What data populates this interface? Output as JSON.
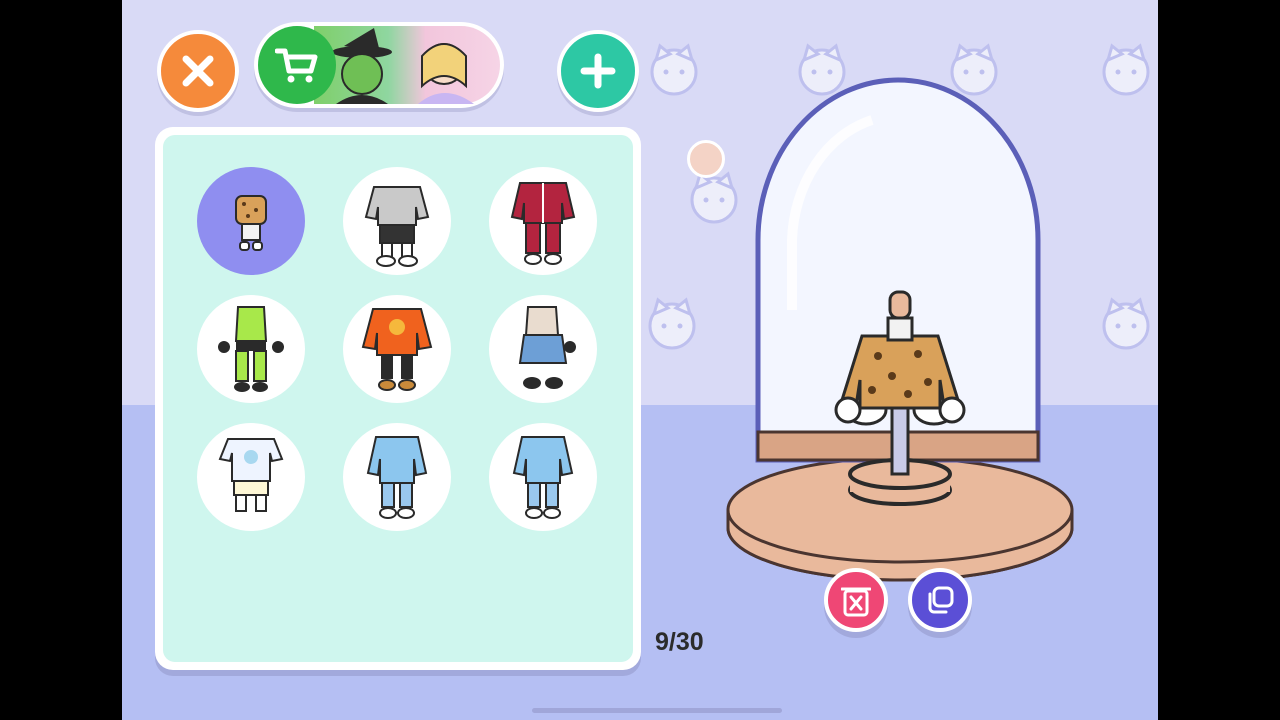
{
  "app": {
    "buttons": {
      "close": "close-icon",
      "shop": "cart-icon",
      "add": "plus-icon",
      "delete": "trash-icon",
      "duplicate": "duplicate-icon"
    },
    "outfit_grid": {
      "items": [
        {
          "name": "leopard-jacket-outfit",
          "selected": true
        },
        {
          "name": "gray-sweater-outfit",
          "selected": false
        },
        {
          "name": "red-tracksuit-outfit",
          "selected": false
        },
        {
          "name": "green-sporty-outfit",
          "selected": false
        },
        {
          "name": "orange-sweater-outfit",
          "selected": false
        },
        {
          "name": "denim-skirt-outfit",
          "selected": false
        },
        {
          "name": "white-tshirt-outfit",
          "selected": false
        },
        {
          "name": "blue-hoodie-outfit",
          "selected": false
        },
        {
          "name": "blue-hoodie-outfit-2",
          "selected": false
        }
      ]
    },
    "counter": "9/30",
    "colors": {
      "wall": "#d9daf6",
      "floor": "#b5bff3",
      "panel": "#cff6ee",
      "selected": "#8f8ef0",
      "close": "#f58a3b",
      "shop": "#2fb84b",
      "add": "#2dc8a4",
      "delete": "#ef4775",
      "duplicate": "#5b4fd6"
    }
  }
}
